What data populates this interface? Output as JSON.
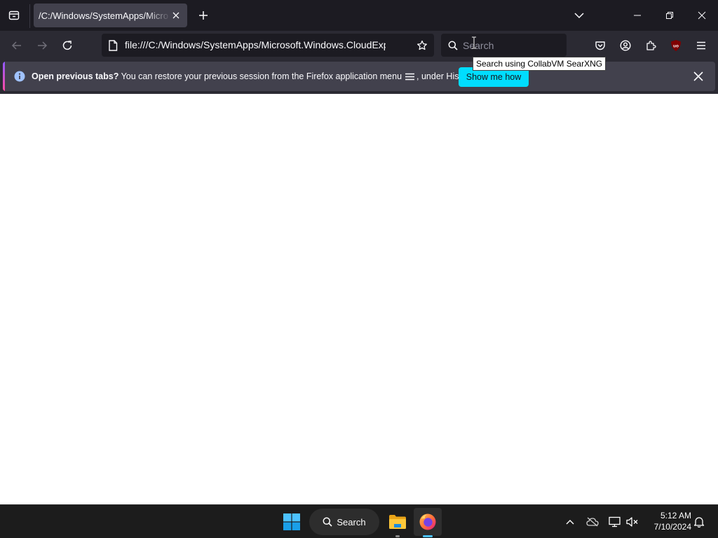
{
  "browser": {
    "tab": {
      "title": "/C:/Windows/SystemApps/Microsoft.Windows.CloudExperienceHost"
    },
    "url": "file:///C:/Windows/SystemApps/Microsoft.Windows.CloudExperienceHost/",
    "search": {
      "placeholder": "Search"
    },
    "tooltip": "Search using CollabVM SearXNG",
    "extension_badge": "uo"
  },
  "notification": {
    "bold": "Open previous tabs?",
    "text": " You can restore your previous session from the Firefox application menu",
    "text_after": ", under History.",
    "button_label": "Show me how"
  },
  "taskbar": {
    "search_label": "Search",
    "time": "5:12 AM",
    "date": "7/10/2024"
  },
  "colors": {
    "accent": "#00ddff",
    "tab_strip": "#1c1b22",
    "toolbar": "#2b2a33",
    "taskbar": "#1c1c1c"
  },
  "icons": [
    "tab-list-icon",
    "close-icon",
    "plus-icon",
    "chevron-down-icon",
    "minimize-icon",
    "restore-icon",
    "back-arrow-icon",
    "forward-arrow-icon",
    "reload-icon",
    "page-icon",
    "bookmark-star-icon",
    "search-icon",
    "pocket-icon",
    "account-icon",
    "extensions-icon",
    "ublock-icon",
    "menu-icon",
    "info-icon",
    "hamburger-icon",
    "windows-start-icon",
    "file-explorer-icon",
    "firefox-icon",
    "chevron-up-icon",
    "cloud-offline-icon",
    "network-icon",
    "volume-muted-icon",
    "notification-bell-icon"
  ]
}
